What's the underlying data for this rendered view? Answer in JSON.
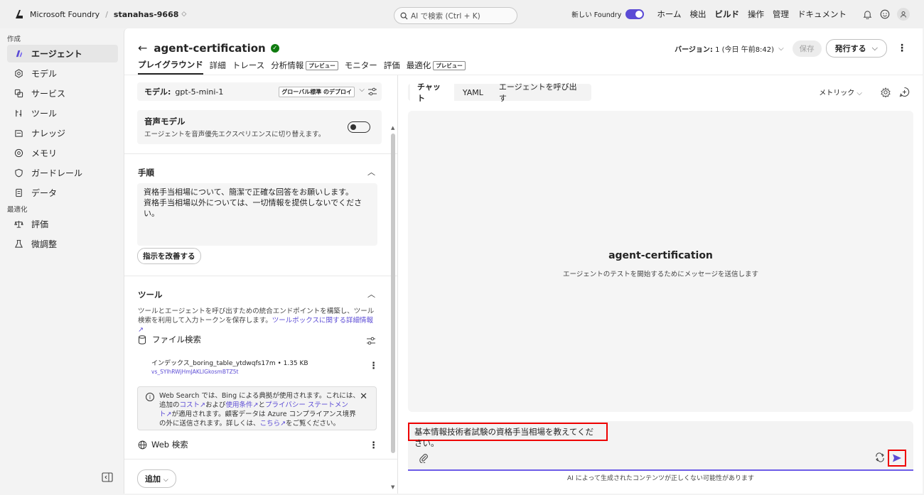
{
  "topbar": {
    "brand": "Microsoft Foundry",
    "separator": "/",
    "project": "stanahas-9668",
    "search_placeholder": "AI で検索 (Ctrl + K)",
    "new_foundry_label": "新しい Foundry",
    "nav": [
      "ホーム",
      "検出",
      "ビルド",
      "操作",
      "管理",
      "ドキュメント"
    ],
    "active_nav": "ビルド"
  },
  "sidebar": {
    "section1": "作成",
    "items1": [
      {
        "label": "エージェント",
        "icon": "agent-icon"
      },
      {
        "label": "モデル",
        "icon": "model-icon"
      },
      {
        "label": "サービス",
        "icon": "service-icon"
      },
      {
        "label": "ツール",
        "icon": "tool-icon"
      },
      {
        "label": "ナレッジ",
        "icon": "knowledge-icon"
      },
      {
        "label": "メモリ",
        "icon": "memory-icon"
      },
      {
        "label": "ガードレール",
        "icon": "guardrail-icon"
      },
      {
        "label": "データ",
        "icon": "data-icon"
      }
    ],
    "section2": "最適化",
    "items2": [
      {
        "label": "評価",
        "icon": "evaluation-icon"
      },
      {
        "label": "微調整",
        "icon": "finetune-icon"
      }
    ]
  },
  "header": {
    "back": "←",
    "title": "agent-certification",
    "tabs": [
      "プレイグラウンド",
      "詳細",
      "トレース",
      "分析情報",
      "モニター",
      "評価",
      "最適化"
    ],
    "preview_badge": "プレビュー",
    "version_label": "バージョン:",
    "version_value": "1 (今日 午前8:42)",
    "save_label": "保存",
    "publish_label": "発行する"
  },
  "config": {
    "model_label": "モデル:",
    "model_value": "gpt-5-mini-1",
    "model_deploy_badge": "グローバル標準 のデプロイ",
    "voice_title": "音声モデル",
    "voice_desc": "エージェントを音声優先エクスペリエンスに切り替えます。",
    "instructions_title": "手順",
    "instructions_line1": "資格手当相場について、簡潔で正確な回答をお願いします。",
    "instructions_line2": "資格手当相場以外については、一切情報を提供しないでくださ",
    "instructions_line3": "い。",
    "improve_label": "指示を改善する",
    "tools_title": "ツール",
    "tools_desc_1": "ツールとエージェントを呼び出すための統合エンドポイントを構築し、ツール検",
    "tools_desc_2": "索を利用して入力トークンを保存します。",
    "tools_link": "ツールボックスに関する詳細情報",
    "file_search_label": "ファイル検索",
    "file_index": "インデックス_boring_table_ytdwqfs17m • 1.35 KB",
    "file_id": "vs_SYlhRWjHmJAKLIGkosmBTZ5t",
    "notice_1a": "Web Search では、Bing による典拠が使用されます。これには、",
    "notice_2a": "追加の",
    "notice_cost": "コスト",
    "notice_2b": "および",
    "notice_terms": "使用条件",
    "notice_2c": "と",
    "notice_privacy_a": "プライバシー ステートメン",
    "notice_privacy_b": "ト",
    "notice_3b": "が適用されます。顧客データは Azure コンプライアンス境界",
    "notice_4a": "の外に送信されます。詳しくは、",
    "notice_here": "こちら",
    "notice_4b": "をご覧ください。",
    "web_search_label": "Web 検索",
    "add_label": "追加"
  },
  "chat": {
    "tabs": [
      "チャット",
      "YAML",
      "エージェントを呼び出す"
    ],
    "metrics_label": "メトリック",
    "empty_title": "agent-certification",
    "empty_sub": "エージェントのテストを開始するためにメッセージを送信します",
    "input_value": "基本情報技術者試験の資格手当相場を教えてください。",
    "disclaimer": "AI によって生成されたコンテンツが正しくない可能性があります"
  },
  "colors": {
    "accent": "#5b4bd5",
    "highlight": "#e00000",
    "success": "#0f7b0f"
  }
}
